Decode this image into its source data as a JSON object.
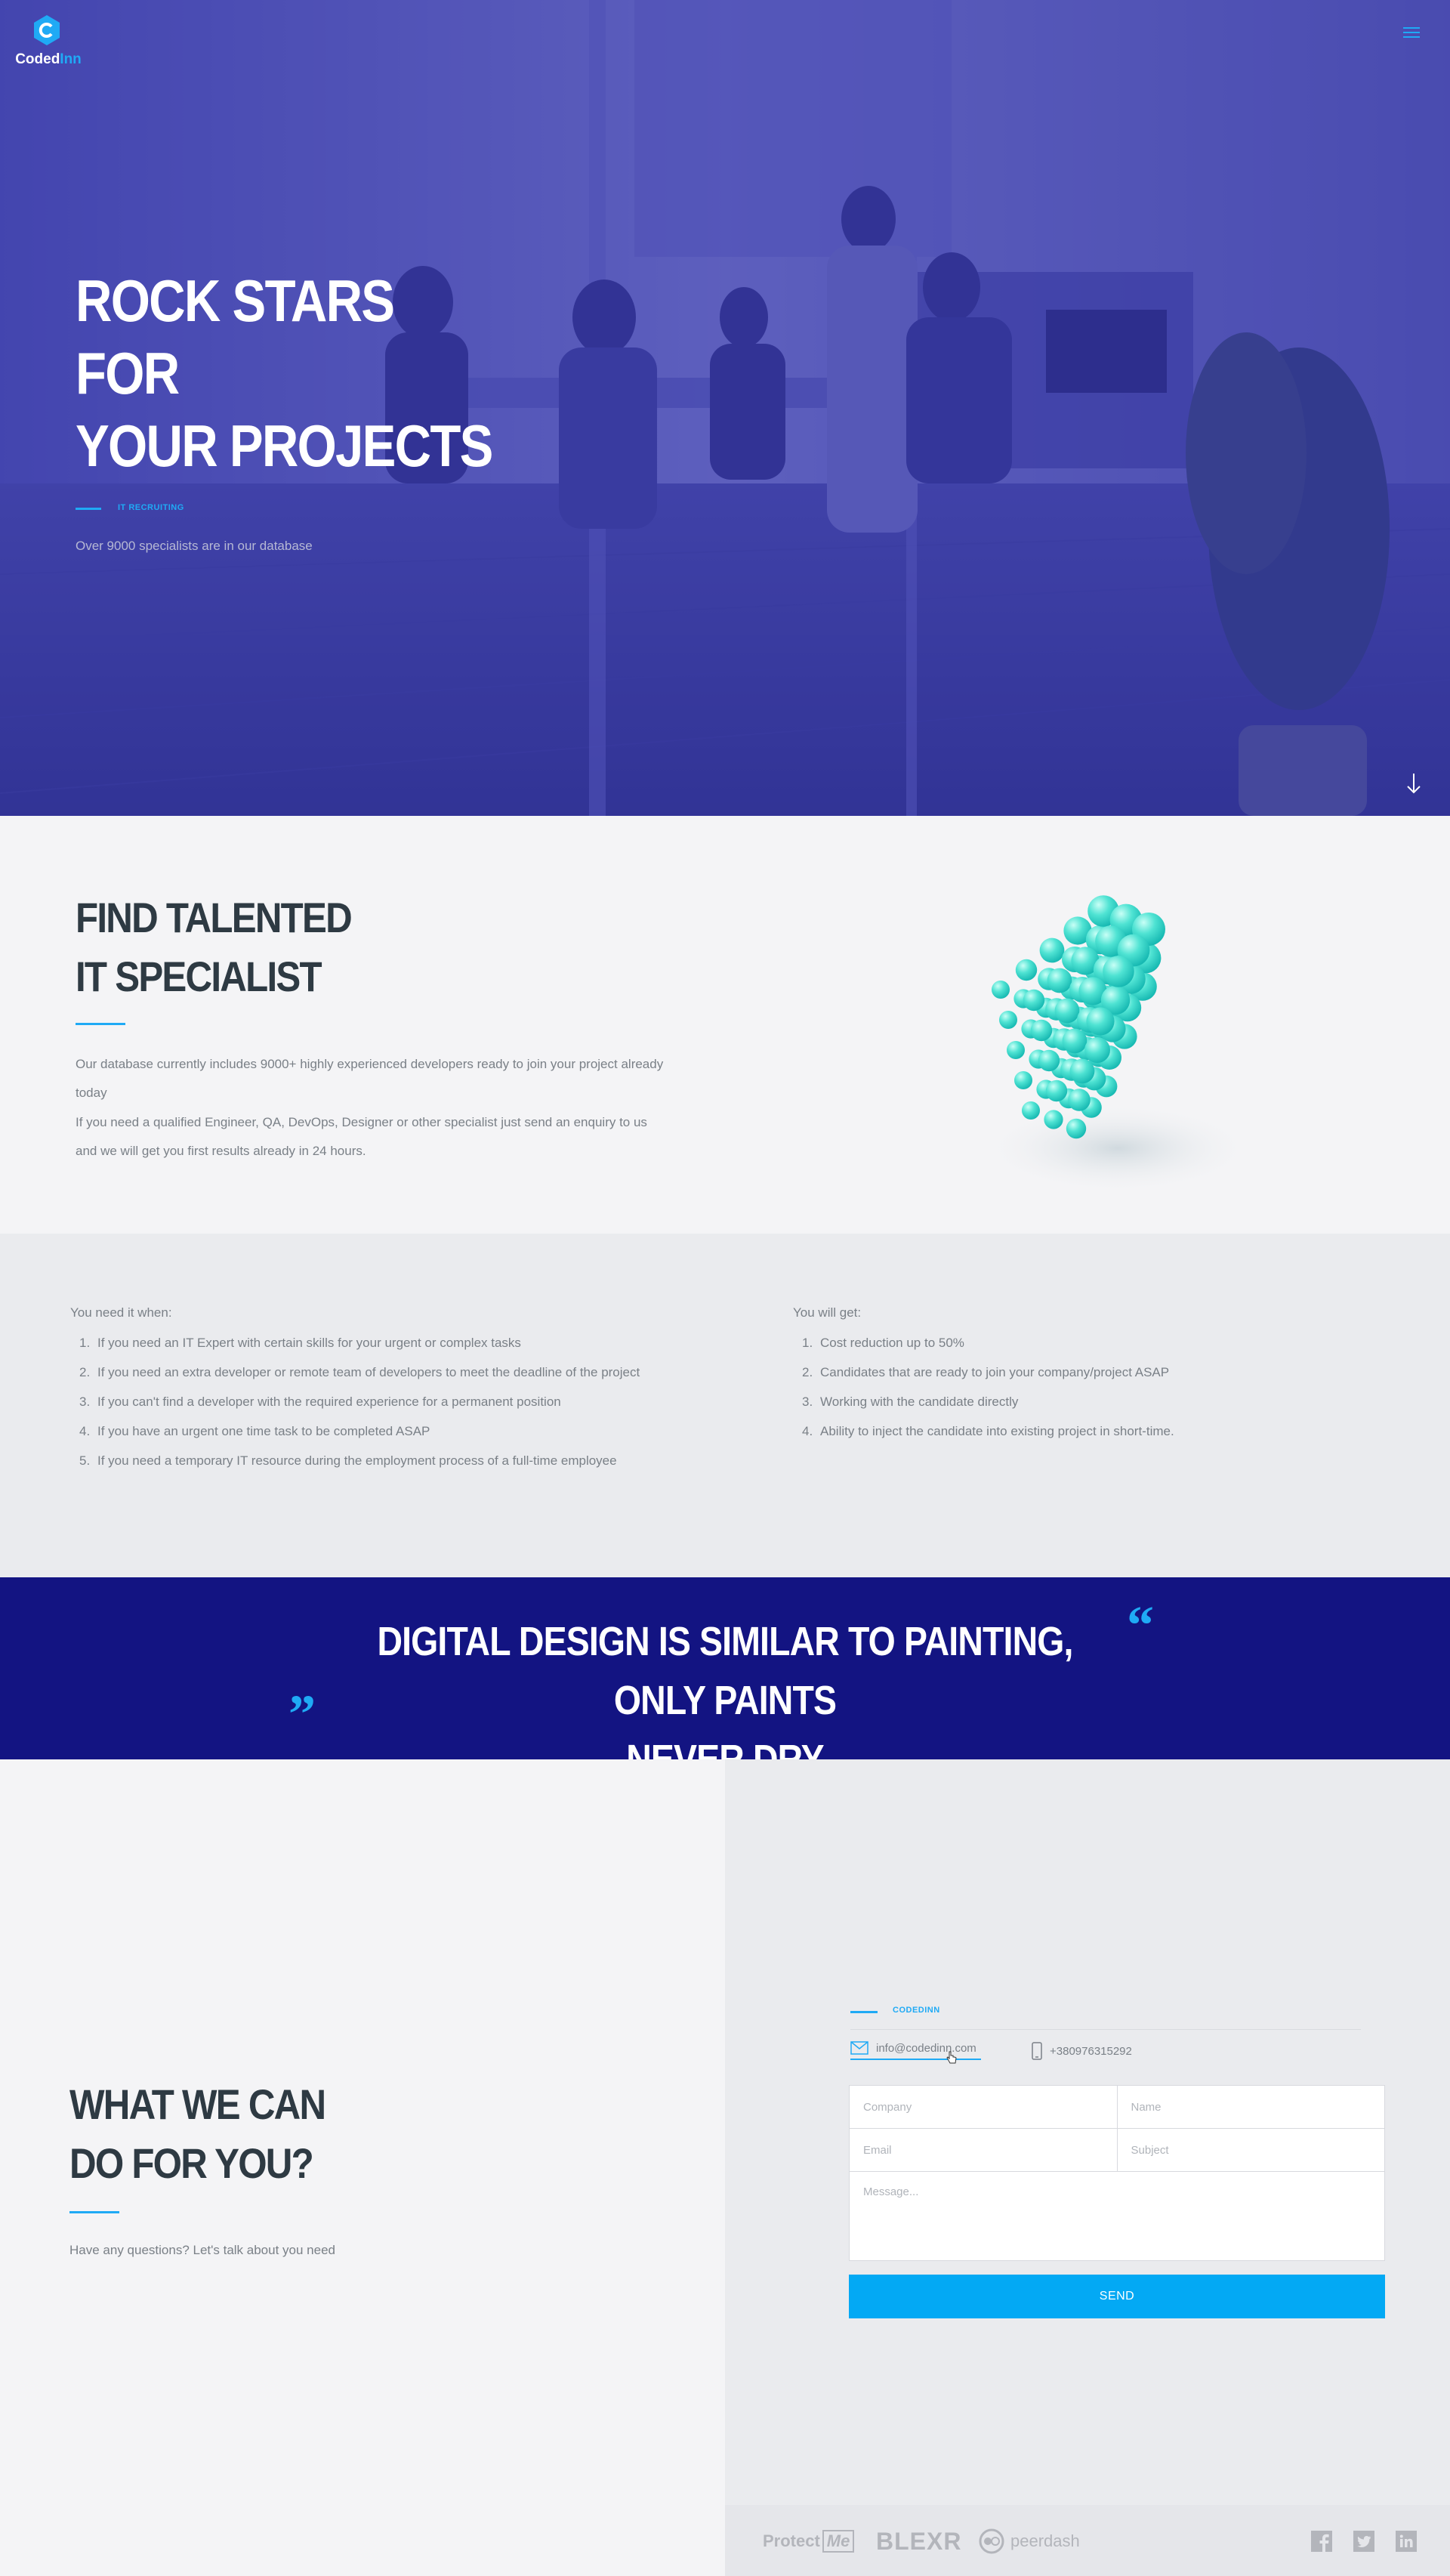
{
  "brand": {
    "name_part1": "Coded",
    "name_part2": "Inn",
    "accent_color": "#1faaf5"
  },
  "hero": {
    "title_lines": [
      "ROCK STARS",
      "FOR",
      "YOUR PROJECTS"
    ],
    "tag": "IT RECRUITING",
    "subtitle": "Over 9000 specialists are in our database"
  },
  "talent": {
    "title_lines": [
      "FIND TALENTED",
      "IT SPECIALIST"
    ],
    "paragraph1": "Our database currently includes 9000+ highly experienced developers ready to join your project already today",
    "paragraph2": "If you need a qualified Engineer, QA, DevOps, Designer or other specialist just send an enquiry to us and we will get you first results already in 24 hours."
  },
  "needs": {
    "heading": "You need it when:",
    "items": [
      "If you need an IT Expert with certain skills for your urgent or complex tasks",
      "If you need an extra developer or remote team of developers to meet the deadline of the project",
      "If you can't find a developer with the required experience for a permanent position",
      "If you have an urgent one time task to be completed ASAP",
      "If you need a temporary IT resource during the employment process of a full-time employee"
    ]
  },
  "benefits": {
    "heading": "You will get:",
    "items": [
      "Cost reduction up to 50%",
      "Candidates that are ready to join your company/project ASAP",
      "Working with the candidate directly",
      "Ability to inject the candidate into existing project in short-time."
    ]
  },
  "quote": {
    "lines": [
      "DIGITAL DESIGN IS SIMILAR TO PAINTING, ONLY PAINTS",
      "NEVER DRY"
    ]
  },
  "contact": {
    "title_lines": [
      "WHAT WE CAN",
      "DO FOR YOU?"
    ],
    "subtitle": "Have any questions? Let's talk about you need",
    "tag": "CODEDINN",
    "email": "info@codedinn.com",
    "phone": "+380976315292",
    "form": {
      "company_placeholder": "Company",
      "name_placeholder": "Name",
      "email_placeholder": "Email",
      "subject_placeholder": "Subject",
      "message_placeholder": "Message...",
      "send_label": "SEND"
    }
  },
  "footer": {
    "partners": [
      "Protect",
      "Me",
      "BLEXR",
      "peerdash"
    ],
    "social_icons": [
      "facebook-icon",
      "twitter-icon",
      "linkedin-icon"
    ]
  }
}
